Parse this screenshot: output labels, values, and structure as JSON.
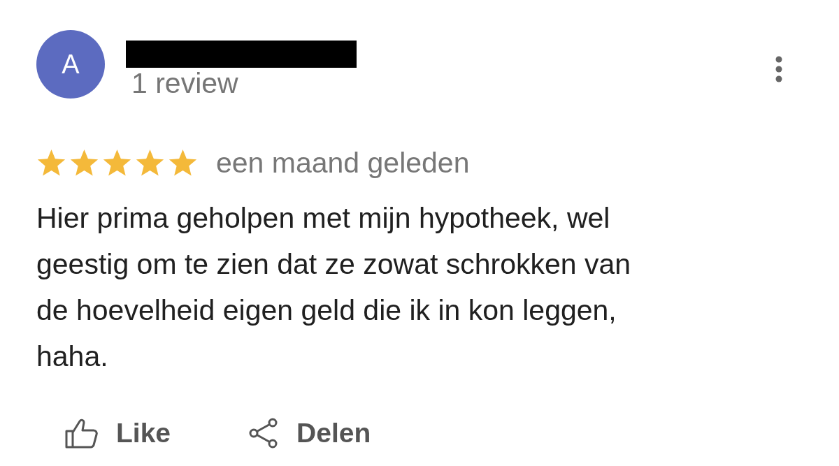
{
  "review": {
    "avatar_letter": "A",
    "reviewer_count": "1 review",
    "stars": 5,
    "date": "een maand geleden",
    "text": "Hier prima geholpen met mijn hypotheek, wel geestig om te zien dat ze zowat schrokken van de hoevelheid eigen geld die ik in kon leggen, haha."
  },
  "actions": [
    {
      "kind": "like",
      "label": "Like"
    },
    {
      "kind": "share",
      "label": "Delen"
    }
  ]
}
